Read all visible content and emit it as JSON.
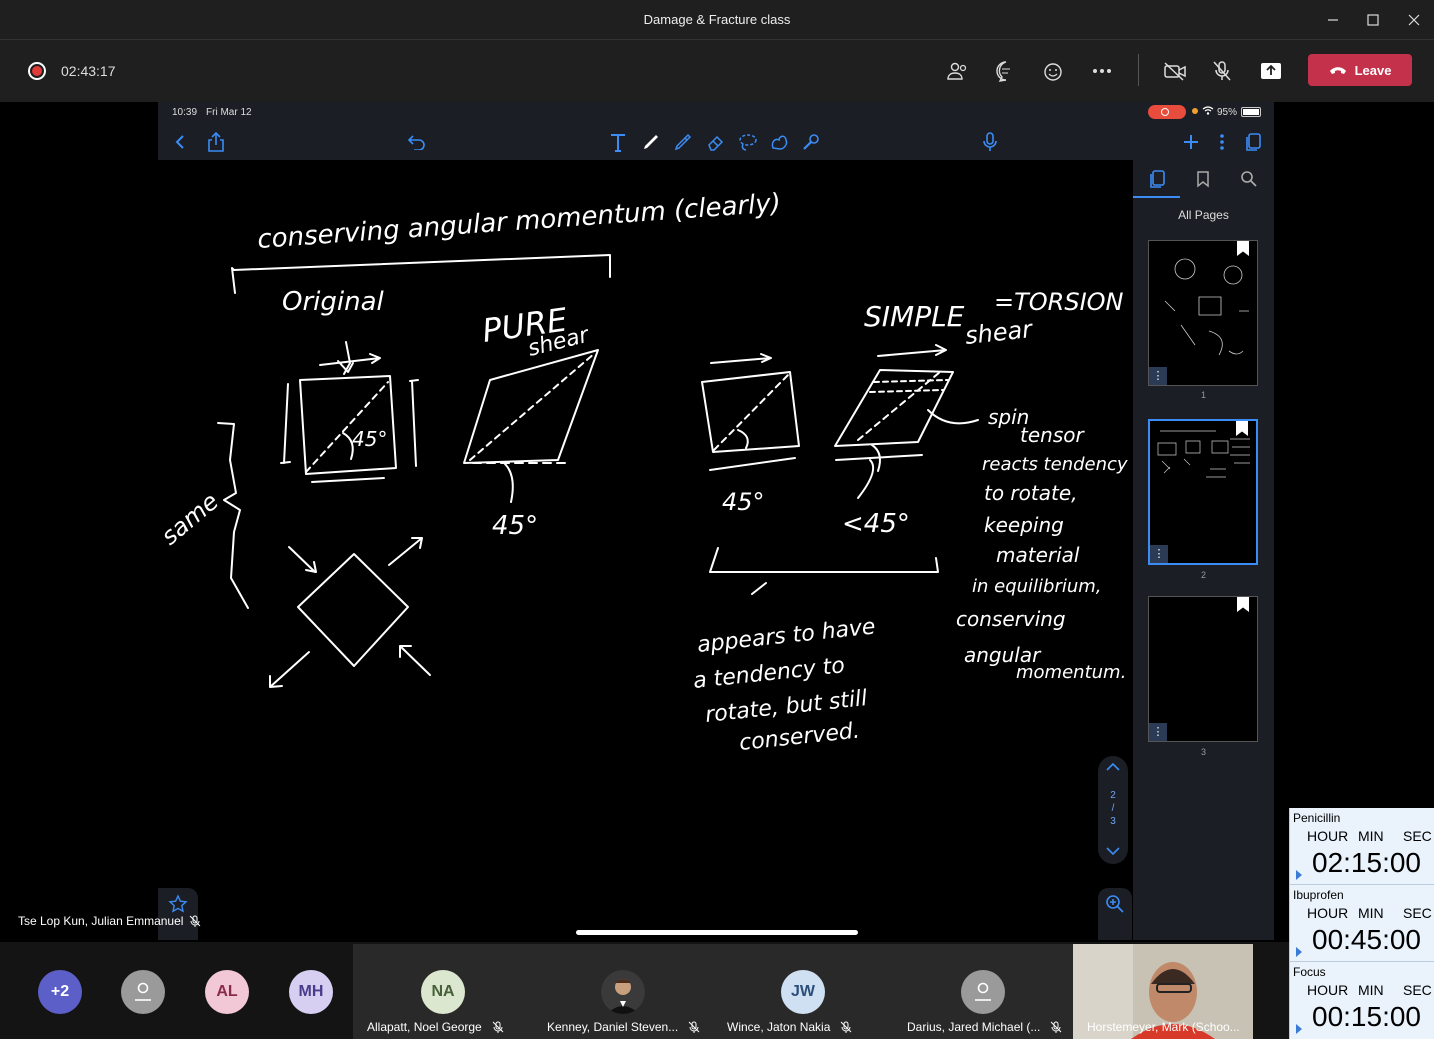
{
  "window": {
    "title": "Damage & Fracture class"
  },
  "meeting": {
    "elapsed": "02:43:17",
    "leave_label": "Leave"
  },
  "ipad": {
    "time": "10:39",
    "date": "Fri Mar 12",
    "battery": "95%",
    "sidebar_title": "All Pages",
    "pages": [
      "1",
      "2",
      "3"
    ],
    "pager_current": "2",
    "pager_sep": "/",
    "pager_total": "3"
  },
  "notes": {
    "title": "conserving angular momentum (clearly)",
    "original": "Original",
    "pure": "PURE",
    "pure_shear": "shear",
    "simple": "SIMPLE",
    "torsion": "=TORSION",
    "simple_shear": "shear",
    "deg_original": "45°",
    "deg_pure": "45°",
    "deg_simple1": "45°",
    "deg_simple2": "<45°",
    "same": "same",
    "appears": [
      "appears to have",
      "a tendency to",
      "rotate, but still",
      "conserved."
    ],
    "spin": [
      "spin",
      "tensor",
      "reacts tendency",
      "to rotate,",
      "keeping",
      "material",
      "in equilibrium,",
      "conserving",
      "angular",
      "momentum."
    ]
  },
  "presenter": {
    "name": "Tse Lop Kun, Julian Emmanuel"
  },
  "participants": {
    "overflow": "+2",
    "initials": [
      "AL",
      "MH"
    ],
    "tiles": [
      {
        "initials": "NA",
        "name": "Allapatt, Noel George"
      },
      {
        "initials": "",
        "name": "Kenney, Daniel Steven..."
      },
      {
        "initials": "JW",
        "name": "Wince, Jaton Nakia"
      },
      {
        "initials": "",
        "name": "Darius, Jared Michael (..."
      },
      {
        "initials": "",
        "name": "Horstemeyer, Mark (Schoo..."
      }
    ]
  },
  "timers": {
    "hour": "HOUR",
    "min": "MIN",
    "sec": "SEC",
    "items": [
      {
        "label": "Penicillin",
        "value": "02:15:00"
      },
      {
        "label": "Ibuprofen",
        "value": "00:45:00"
      },
      {
        "label": "Focus",
        "value": "00:15:00"
      }
    ]
  },
  "colors": {
    "leave": "#c4314b",
    "accent": "#3b8cf5",
    "recording": "#e03a3a"
  }
}
